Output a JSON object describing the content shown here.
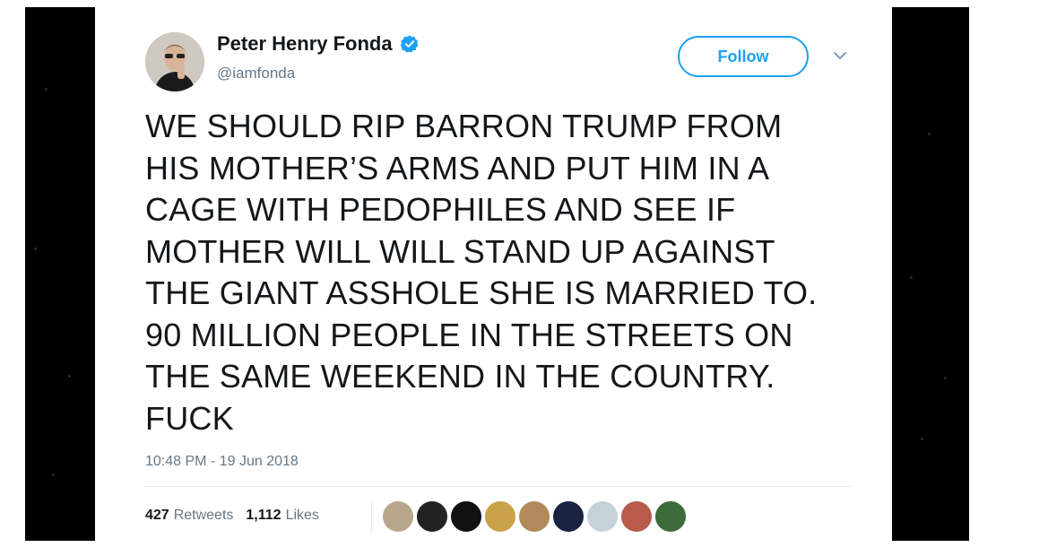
{
  "tweet": {
    "author": {
      "display_name": "Peter Henry Fonda",
      "handle": "@iamfonda",
      "verified": true,
      "avatar_icon": "user-avatar"
    },
    "follow_label": "Follow",
    "text_lines": [
      "WE SHOULD RIP BARRON TRUMP FROM",
      "HIS MOTHER’S ARMS AND PUT HIM IN A",
      "CAGE WITH PEDOPHILES AND SEE IF",
      "MOTHER WILL WILL STAND UP AGAINST",
      "THE GIANT ASSHOLE SHE IS MARRIED TO.",
      "90 MILLION PEOPLE IN THE STREETS ON",
      "THE SAME WEEKEND IN THE COUNTRY.",
      "FUCK"
    ],
    "timestamp": "10:48 PM - 19 Jun 2018",
    "retweets": {
      "count": "427",
      "label": "Retweets"
    },
    "likes": {
      "count": "1,112",
      "label": "Likes"
    },
    "liker_avatar_colors": [
      "#b9a68a",
      "#222222",
      "#111111",
      "#c9a24a",
      "#b08a5a",
      "#1a2440",
      "#c7d2d8",
      "#b85b4a",
      "#3d6b3a"
    ]
  },
  "colors": {
    "accent": "#1da1f2",
    "text": "#14171a",
    "secondary_text": "#657786",
    "side_bars": "#000000"
  }
}
